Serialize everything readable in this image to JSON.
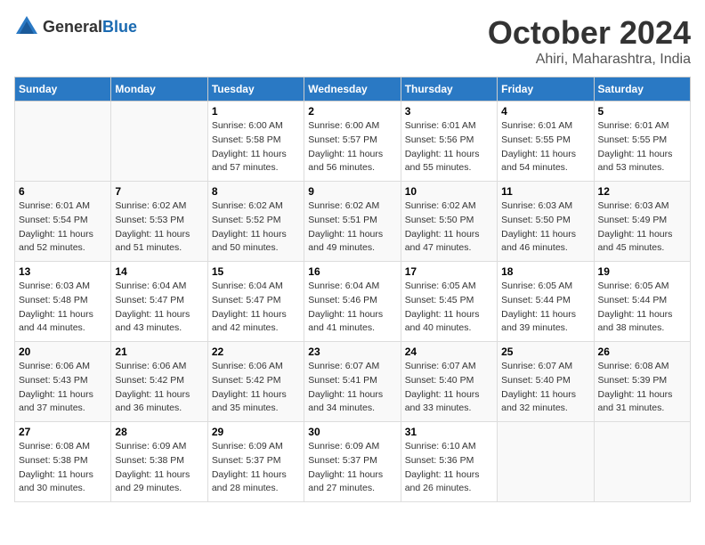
{
  "header": {
    "logo_general": "General",
    "logo_blue": "Blue",
    "month": "October 2024",
    "location": "Ahiri, Maharashtra, India"
  },
  "weekdays": [
    "Sunday",
    "Monday",
    "Tuesday",
    "Wednesday",
    "Thursday",
    "Friday",
    "Saturday"
  ],
  "weeks": [
    [
      {
        "day": "",
        "info": ""
      },
      {
        "day": "",
        "info": ""
      },
      {
        "day": "1",
        "info": "Sunrise: 6:00 AM\nSunset: 5:58 PM\nDaylight: 11 hours and 57 minutes."
      },
      {
        "day": "2",
        "info": "Sunrise: 6:00 AM\nSunset: 5:57 PM\nDaylight: 11 hours and 56 minutes."
      },
      {
        "day": "3",
        "info": "Sunrise: 6:01 AM\nSunset: 5:56 PM\nDaylight: 11 hours and 55 minutes."
      },
      {
        "day": "4",
        "info": "Sunrise: 6:01 AM\nSunset: 5:55 PM\nDaylight: 11 hours and 54 minutes."
      },
      {
        "day": "5",
        "info": "Sunrise: 6:01 AM\nSunset: 5:55 PM\nDaylight: 11 hours and 53 minutes."
      }
    ],
    [
      {
        "day": "6",
        "info": "Sunrise: 6:01 AM\nSunset: 5:54 PM\nDaylight: 11 hours and 52 minutes."
      },
      {
        "day": "7",
        "info": "Sunrise: 6:02 AM\nSunset: 5:53 PM\nDaylight: 11 hours and 51 minutes."
      },
      {
        "day": "8",
        "info": "Sunrise: 6:02 AM\nSunset: 5:52 PM\nDaylight: 11 hours and 50 minutes."
      },
      {
        "day": "9",
        "info": "Sunrise: 6:02 AM\nSunset: 5:51 PM\nDaylight: 11 hours and 49 minutes."
      },
      {
        "day": "10",
        "info": "Sunrise: 6:02 AM\nSunset: 5:50 PM\nDaylight: 11 hours and 47 minutes."
      },
      {
        "day": "11",
        "info": "Sunrise: 6:03 AM\nSunset: 5:50 PM\nDaylight: 11 hours and 46 minutes."
      },
      {
        "day": "12",
        "info": "Sunrise: 6:03 AM\nSunset: 5:49 PM\nDaylight: 11 hours and 45 minutes."
      }
    ],
    [
      {
        "day": "13",
        "info": "Sunrise: 6:03 AM\nSunset: 5:48 PM\nDaylight: 11 hours and 44 minutes."
      },
      {
        "day": "14",
        "info": "Sunrise: 6:04 AM\nSunset: 5:47 PM\nDaylight: 11 hours and 43 minutes."
      },
      {
        "day": "15",
        "info": "Sunrise: 6:04 AM\nSunset: 5:47 PM\nDaylight: 11 hours and 42 minutes."
      },
      {
        "day": "16",
        "info": "Sunrise: 6:04 AM\nSunset: 5:46 PM\nDaylight: 11 hours and 41 minutes."
      },
      {
        "day": "17",
        "info": "Sunrise: 6:05 AM\nSunset: 5:45 PM\nDaylight: 11 hours and 40 minutes."
      },
      {
        "day": "18",
        "info": "Sunrise: 6:05 AM\nSunset: 5:44 PM\nDaylight: 11 hours and 39 minutes."
      },
      {
        "day": "19",
        "info": "Sunrise: 6:05 AM\nSunset: 5:44 PM\nDaylight: 11 hours and 38 minutes."
      }
    ],
    [
      {
        "day": "20",
        "info": "Sunrise: 6:06 AM\nSunset: 5:43 PM\nDaylight: 11 hours and 37 minutes."
      },
      {
        "day": "21",
        "info": "Sunrise: 6:06 AM\nSunset: 5:42 PM\nDaylight: 11 hours and 36 minutes."
      },
      {
        "day": "22",
        "info": "Sunrise: 6:06 AM\nSunset: 5:42 PM\nDaylight: 11 hours and 35 minutes."
      },
      {
        "day": "23",
        "info": "Sunrise: 6:07 AM\nSunset: 5:41 PM\nDaylight: 11 hours and 34 minutes."
      },
      {
        "day": "24",
        "info": "Sunrise: 6:07 AM\nSunset: 5:40 PM\nDaylight: 11 hours and 33 minutes."
      },
      {
        "day": "25",
        "info": "Sunrise: 6:07 AM\nSunset: 5:40 PM\nDaylight: 11 hours and 32 minutes."
      },
      {
        "day": "26",
        "info": "Sunrise: 6:08 AM\nSunset: 5:39 PM\nDaylight: 11 hours and 31 minutes."
      }
    ],
    [
      {
        "day": "27",
        "info": "Sunrise: 6:08 AM\nSunset: 5:38 PM\nDaylight: 11 hours and 30 minutes."
      },
      {
        "day": "28",
        "info": "Sunrise: 6:09 AM\nSunset: 5:38 PM\nDaylight: 11 hours and 29 minutes."
      },
      {
        "day": "29",
        "info": "Sunrise: 6:09 AM\nSunset: 5:37 PM\nDaylight: 11 hours and 28 minutes."
      },
      {
        "day": "30",
        "info": "Sunrise: 6:09 AM\nSunset: 5:37 PM\nDaylight: 11 hours and 27 minutes."
      },
      {
        "day": "31",
        "info": "Sunrise: 6:10 AM\nSunset: 5:36 PM\nDaylight: 11 hours and 26 minutes."
      },
      {
        "day": "",
        "info": ""
      },
      {
        "day": "",
        "info": ""
      }
    ]
  ]
}
